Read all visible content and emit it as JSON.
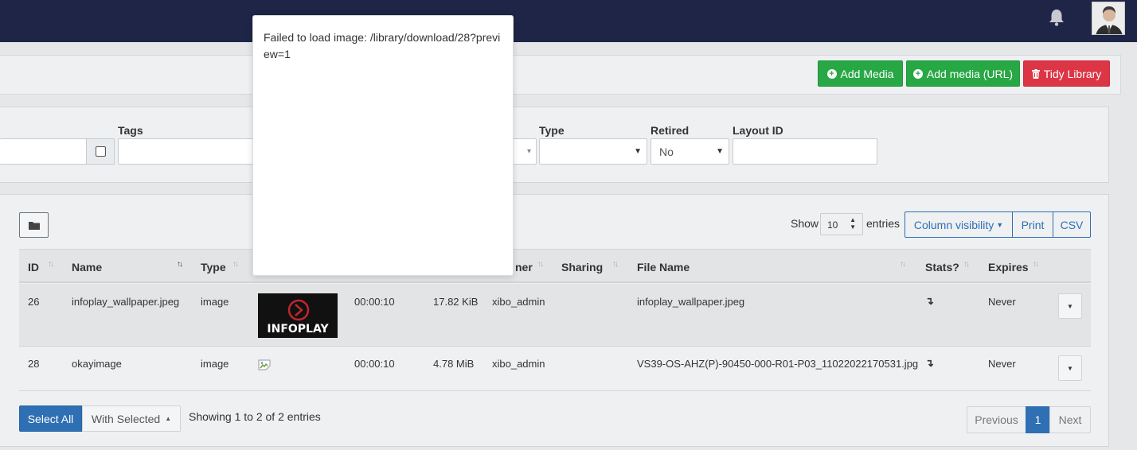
{
  "header": {
    "bell_icon": "bell-icon",
    "avatar": "user-avatar"
  },
  "toolbar": {
    "add_media": "Add Media",
    "add_media_url": "Add media (URL)",
    "tidy_library": "Tidy Library",
    "colors": {
      "green": "#28a745",
      "red": "#dc3545",
      "nav": "#1e2546",
      "primary": "#2f6fb3"
    }
  },
  "filters": {
    "tags_label": "Tags",
    "type_label": "Type",
    "retired_label": "Retired",
    "retired_value": "No",
    "layout_id_label": "Layout ID"
  },
  "table_controls": {
    "show_label": "Show",
    "page_length": "10",
    "entries_label": "entries",
    "column_visibility": "Column visibility",
    "print": "Print",
    "csv": "CSV"
  },
  "columns": {
    "id": "ID",
    "name": "Name",
    "type": "Type",
    "owner": "ner",
    "sharing": "Sharing",
    "file_name": "File Name",
    "stats": "Stats?",
    "expires": "Expires"
  },
  "rows": [
    {
      "id": "26",
      "name": "infoplay_wallpaper.jpeg",
      "type": "image",
      "thumb_text": "INFOPLAY",
      "duration": "00:00:10",
      "size": "17.82 KiB",
      "owner": "xibo_admin",
      "file_name": "infoplay_wallpaper.jpeg",
      "stats": "↴",
      "expires": "Never"
    },
    {
      "id": "28",
      "name": "okayimage",
      "type": "image",
      "duration": "00:00:10",
      "size": "4.78 MiB",
      "owner": "xibo_admin",
      "file_name": "VS39-OS-AHZ(P)-90450-000-R01-P03_11022022170531.jpg",
      "stats": "↴",
      "expires": "Never"
    }
  ],
  "footer": {
    "select_all": "Select All",
    "with_selected": "With Selected",
    "showing": "Showing 1 to 2 of 2 entries",
    "previous": "Previous",
    "page": "1",
    "next": "Next"
  },
  "modal": {
    "message": "Failed to load image: /library/download/28?preview=1"
  }
}
